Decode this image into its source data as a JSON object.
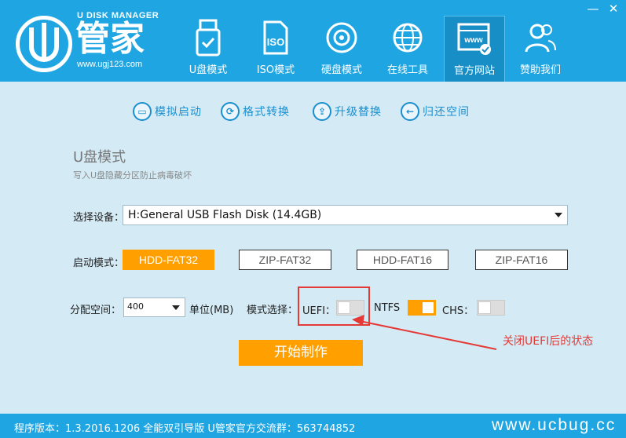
{
  "app": {
    "brand_top": "U DISK MANAGER",
    "brand_name": "管家",
    "brand_url": "www.ugj123.com"
  },
  "nav": [
    {
      "label": "U盘模式",
      "icon": "usb-drive-icon"
    },
    {
      "label": "ISO模式",
      "icon": "iso-file-icon"
    },
    {
      "label": "硬盘模式",
      "icon": "hard-disk-icon"
    },
    {
      "label": "在线工具",
      "icon": "globe-icon"
    },
    {
      "label": "官方网站",
      "icon": "website-icon"
    },
    {
      "label": "赞助我们",
      "icon": "users-icon"
    }
  ],
  "window": {
    "minimize": "—",
    "close": "✕"
  },
  "subnav": [
    {
      "label": "模拟启动",
      "icon": "monitor-icon"
    },
    {
      "label": "格式转换",
      "icon": "convert-icon"
    },
    {
      "label": "升级替换",
      "icon": "upgrade-icon"
    },
    {
      "label": "归还空间",
      "icon": "back-arrow-icon"
    }
  ],
  "section": {
    "title": "U盘模式",
    "subtitle": "写入U盘隐藏分区防止病毒破坏"
  },
  "device": {
    "label": "选择设备：",
    "value": "H:General USB Flash Disk (14.4GB)"
  },
  "boot_mode": {
    "label": "启动模式：",
    "options": [
      "HDD-FAT32",
      "ZIP-FAT32",
      "HDD-FAT16",
      "ZIP-FAT16"
    ],
    "selected": "HDD-FAT32"
  },
  "alloc": {
    "label": "分配空间：",
    "value": "400",
    "unit": "单位(MB)",
    "mode_label": "模式选择：",
    "uefi_label": "UEFI：",
    "uefi_on": false,
    "ntfs_label": "NTFS",
    "ntfs_on": true,
    "chs_label": "CHS：",
    "chs_on": false
  },
  "annotation": "关闭UEFI后的状态",
  "start_button": "开始制作",
  "footer": {
    "text": "程序版本：1.3.2016.1206 全能双引导版 U管家官方交流群：563744852"
  },
  "watermark": "www.ucbug.cc",
  "colors": {
    "header": "#1fa6e2",
    "accent": "#ffa000",
    "background": "#d4eaf5",
    "annotation": "#e53935"
  }
}
